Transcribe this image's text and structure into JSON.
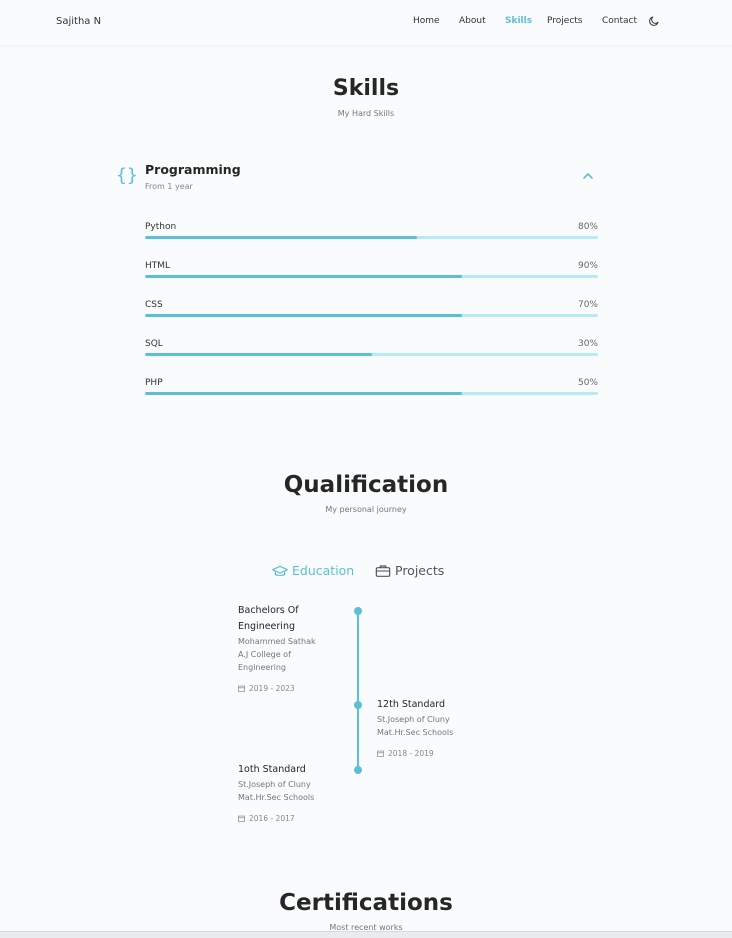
{
  "header": {
    "logo": "Sajitha N",
    "nav": [
      "Home",
      "About",
      "Skills",
      "Projects",
      "Contact"
    ],
    "active_nav": "Skills",
    "theme_icon": "moon-icon"
  },
  "skills_section": {
    "title": "Skills",
    "subtitle": "My Hard Skills",
    "group": {
      "icon": "curly-braces-icon",
      "title": "Programming",
      "subtitle": "From 1 year",
      "toggle_icon": "chevron-up-icon"
    },
    "items": [
      {
        "name": "Python",
        "percent_label": "80%",
        "bar_fraction": 0.6
      },
      {
        "name": "HTML",
        "percent_label": "90%",
        "bar_fraction": 0.7
      },
      {
        "name": "CSS",
        "percent_label": "70%",
        "bar_fraction": 0.7
      },
      {
        "name": "SQL",
        "percent_label": "30%",
        "bar_fraction": 0.5
      },
      {
        "name": "PHP",
        "percent_label": "50%",
        "bar_fraction": 0.7
      }
    ]
  },
  "qualification": {
    "title": "Qualification",
    "subtitle": "My personal journey",
    "tabs": [
      {
        "label": "Education",
        "icon": "graduation-cap-icon",
        "active": true
      },
      {
        "label": "Projects",
        "icon": "briefcase-icon",
        "active": false
      }
    ],
    "items": [
      {
        "title_line1": "Bachelors Of",
        "title_line2": "Engineering",
        "sub_line1": "Mohammed Sathak",
        "sub_line2": "A.J College of",
        "sub_line3": "Engineering",
        "date": "2019 - 2023"
      },
      {
        "title_line1": "12th Standard",
        "sub_line1": "St.Joseph of Cluny",
        "sub_line2": "Mat.Hr.Sec Schools",
        "date": "2018 - 2019"
      },
      {
        "title_line1": "1oth Standard",
        "sub_line1": "St.Joseph of Cluny",
        "sub_line2": "Mat.Hr.Sec Schools",
        "date": "2016 - 2017"
      }
    ]
  },
  "certifications": {
    "title": "Certifications",
    "subtitle": "Most recent works"
  },
  "colors": {
    "accent": "#5bc0d6",
    "track": "#b3ecf2",
    "background": "#f9fbfc"
  }
}
